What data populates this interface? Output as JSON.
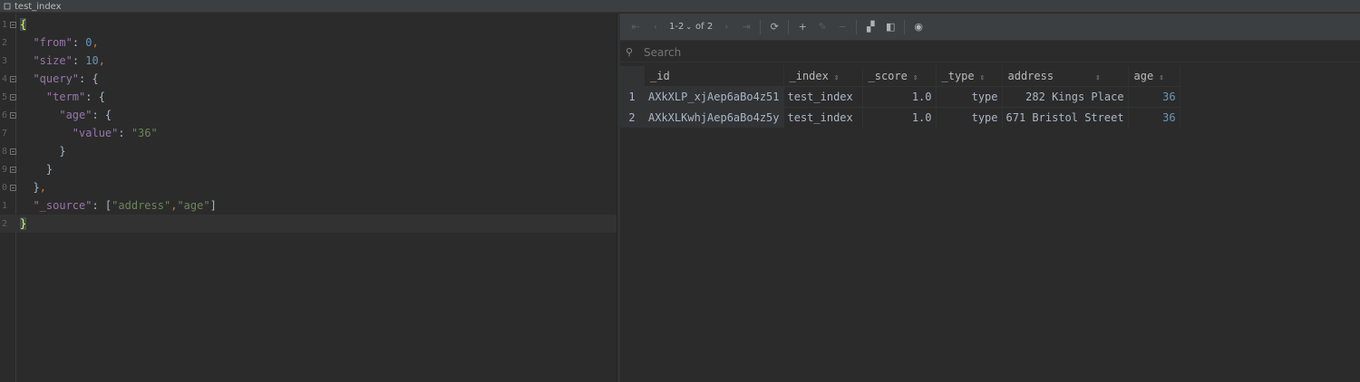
{
  "tab": {
    "title": "test_index"
  },
  "editor": {
    "lines": [
      {
        "num": "1",
        "fold": true,
        "current": false
      },
      {
        "num": "2",
        "fold": false,
        "current": false
      },
      {
        "num": "3",
        "fold": false,
        "current": false
      },
      {
        "num": "4",
        "fold": true,
        "current": false
      },
      {
        "num": "5",
        "fold": true,
        "current": false
      },
      {
        "num": "6",
        "fold": true,
        "current": false
      },
      {
        "num": "7",
        "fold": false,
        "current": false
      },
      {
        "num": "8",
        "fold": true,
        "current": false
      },
      {
        "num": "9",
        "fold": true,
        "current": false
      },
      {
        "num": "0",
        "fold": true,
        "current": false
      },
      {
        "num": "1",
        "fold": false,
        "current": false
      },
      {
        "num": "2",
        "fold": false,
        "current": true
      }
    ],
    "tokens": {
      "l1": "{",
      "from_key": "\"from\"",
      "from_val": "0",
      "size_key": "\"size\"",
      "size_val": "10",
      "query_key": "\"query\"",
      "term_key": "\"term\"",
      "age_key": "\"age\"",
      "value_key": "\"value\"",
      "value_val": "\"36\"",
      "source_key": "\"_source\"",
      "source_a": "\"address\"",
      "source_b": "\"age\"",
      "end": "}"
    }
  },
  "toolbar": {
    "pager_range": "1-2",
    "pager_total": "of 2"
  },
  "search": {
    "placeholder": "Search"
  },
  "table": {
    "columns": [
      "_id",
      "_index",
      "_score",
      "_type",
      "address",
      "age"
    ],
    "rows": [
      {
        "rn": "1",
        "id": "AXkXLP_xjAep6aBo4z51",
        "index": "test_index",
        "score": "1.0",
        "type": "type",
        "address": "282 Kings Place",
        "age": "36"
      },
      {
        "rn": "2",
        "id": "AXkXLKwhjAep6aBo4z5y",
        "index": "test_index",
        "score": "1.0",
        "type": "type",
        "address": "671 Bristol Street",
        "age": "36"
      }
    ]
  }
}
